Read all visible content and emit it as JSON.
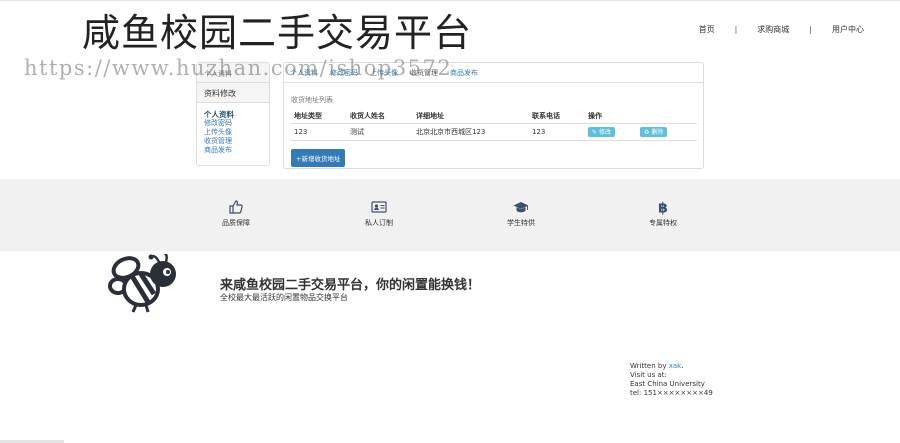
{
  "site": {
    "title": "咸鱼校园二手交易平台",
    "watermark": "https://www.huzhan.com/ishop3572"
  },
  "nav": {
    "items": [
      {
        "label": "首页"
      },
      {
        "label": "求购商城"
      },
      {
        "label": "用户中心"
      }
    ],
    "separator": "|"
  },
  "sidebar": {
    "header_top": "个人资料",
    "header": "资料修改",
    "items": [
      {
        "label": "个人资料"
      },
      {
        "label": "修改密码"
      },
      {
        "label": "上传头像"
      },
      {
        "label": "收货管理"
      },
      {
        "label": "商品发布"
      }
    ]
  },
  "panel": {
    "tabs": [
      {
        "label": "个人资料"
      },
      {
        "label": "修改密码"
      },
      {
        "label": "上传头像"
      },
      {
        "label": "收货管理"
      },
      {
        "label": "商品发布"
      }
    ],
    "caption": "收货地址列表",
    "columns": [
      "地址类型",
      "收货人姓名",
      "详细地址",
      "联系电话",
      "操作"
    ],
    "rows": [
      {
        "type": "123",
        "name": "测试",
        "address": "北京北京市西城区123",
        "phone": "123",
        "edit": "修改",
        "delete": "删除"
      }
    ],
    "add_button": "+新增收货地址"
  },
  "features": [
    {
      "label": "品质保障",
      "icon": "thumbs-up-icon"
    },
    {
      "label": "私人订制",
      "icon": "id-card-icon"
    },
    {
      "label": "学生特供",
      "icon": "graduation-cap-icon"
    },
    {
      "label": "专属特权",
      "icon": "bitcoin-icon"
    }
  ],
  "footer": {
    "slogan": "来咸鱼校园二手交易平台，你的闲置能换钱！",
    "sub_slogan": "全校最大最活跃的闲置物品交换平台",
    "written_by": "Written by",
    "author": "xak",
    "author_end": ".",
    "visit": "Visit us at:",
    "location": "East China University",
    "tel": "tel:  151××××××××49"
  },
  "colors": {
    "link": "#337ab7",
    "info_button": "#5bc0de",
    "primary_button": "#337ab7",
    "feature_band": "#f1f1f1",
    "icon": "#3c4f70"
  }
}
